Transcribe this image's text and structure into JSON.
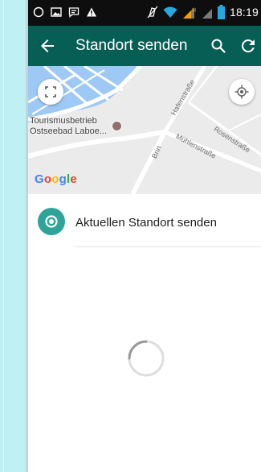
{
  "app": {
    "title": "Standort senden",
    "status_time": "18:19",
    "accent_color": "#075e54"
  },
  "statusbar": {
    "left_icons": [
      "circle-notification-icon",
      "image-notification-icon",
      "message-notification-icon",
      "warning-icon"
    ],
    "right_icons": [
      "mute-icon",
      "wifi-icon",
      "signal-icon",
      "signal-icon",
      "battery-icon"
    ]
  },
  "toolbar": {
    "back_icon": "arrow-back-icon",
    "search_icon": "search-icon",
    "refresh_icon": "refresh-icon"
  },
  "map": {
    "poi_label_line1": "Tourismusbetrieb",
    "poi_label_line2": "Ostseebad Laboe...",
    "streets": [
      "Hafenstraße",
      "Mühlenstraße",
      "Rosenstraße",
      "Brin"
    ],
    "google_letters": [
      {
        "ch": "G",
        "color": "#4285f4"
      },
      {
        "ch": "o",
        "color": "#ea4335"
      },
      {
        "ch": "o",
        "color": "#fbbc05"
      },
      {
        "ch": "g",
        "color": "#4285f4"
      },
      {
        "ch": "l",
        "color": "#34a853"
      },
      {
        "ch": "e",
        "color": "#ea4335"
      }
    ]
  },
  "send_current_location": {
    "label": "Aktuellen Standort senden",
    "icon": "location-pin-icon",
    "icon_color": "#2fa59a"
  },
  "loading": {
    "icon": "loading-spinner-icon"
  }
}
